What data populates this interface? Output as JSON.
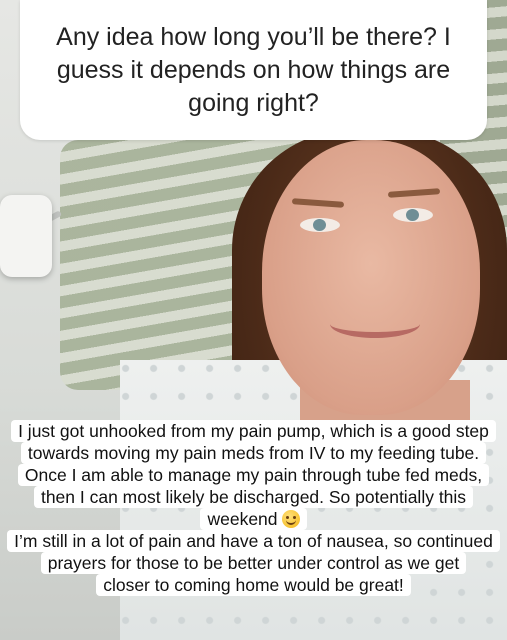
{
  "question_box": {
    "text": "Any idea how long you’ll be there? I guess it depends on how things are going right?"
  },
  "caption": {
    "lines": [
      "I just got unhooked from my pain pump, which is a good step",
      "towards moving my pain meds from IV to my feeding tube.",
      "Once I am able to manage my pain through tube fed meds,",
      "then I can most likely be discharged. So potentially this",
      "weekend",
      "I’m still in a lot of pain and have a ton of nausea, so continued",
      "prayers for those to be better under control as we get",
      "closer to coming home would be great!"
    ],
    "emoji_icon": "smiling-face-emoji"
  }
}
